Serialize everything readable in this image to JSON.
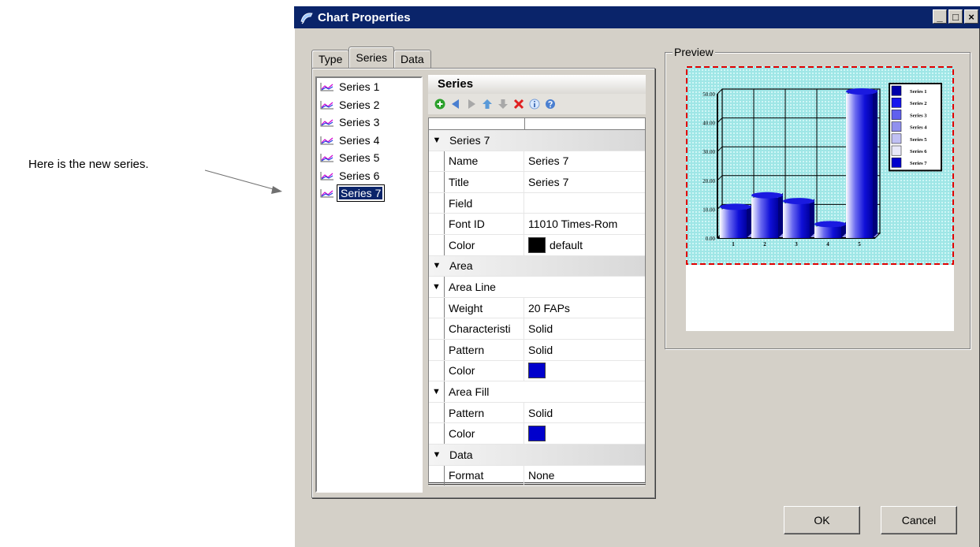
{
  "annotation": {
    "text": "Here is the new series."
  },
  "window": {
    "title": "Chart Properties",
    "controls": {
      "minimize": "_",
      "maximize": "□",
      "close": "×"
    }
  },
  "tabs": [
    "Type",
    "Series",
    "Data"
  ],
  "series_list": [
    "Series 1",
    "Series 2",
    "Series 3",
    "Series 4",
    "Series 5",
    "Series 6",
    "Series 7"
  ],
  "properties": {
    "header": "Series",
    "rows": [
      {
        "kind": "group",
        "label": "Series 7"
      },
      {
        "kind": "prop",
        "name": "Name",
        "value": "Series 7"
      },
      {
        "kind": "prop",
        "name": "Title",
        "value": "Series 7"
      },
      {
        "kind": "prop",
        "name": "Field",
        "value": ""
      },
      {
        "kind": "prop",
        "name": "Font ID",
        "value": "11010 Times-Rom"
      },
      {
        "kind": "prop",
        "name": "Color",
        "value": "default",
        "swatch": "#000000"
      },
      {
        "kind": "group",
        "label": "Area"
      },
      {
        "kind": "subgroup",
        "label": "Area Line"
      },
      {
        "kind": "prop",
        "name": "Weight",
        "value": "20 FAPs"
      },
      {
        "kind": "prop",
        "name": "Characteristi",
        "value": "Solid"
      },
      {
        "kind": "prop",
        "name": "Pattern",
        "value": "Solid"
      },
      {
        "kind": "prop",
        "name": "Color",
        "value": "",
        "swatch": "#0000cc"
      },
      {
        "kind": "subgroup",
        "label": "Area Fill"
      },
      {
        "kind": "prop",
        "name": "Pattern",
        "value": "Solid"
      },
      {
        "kind": "prop",
        "name": "Color",
        "value": "",
        "swatch": "#0000cc"
      },
      {
        "kind": "group",
        "label": "Data"
      },
      {
        "kind": "prop",
        "name": "Format",
        "value": "None"
      }
    ]
  },
  "preview": {
    "label": "Preview",
    "chart_data": {
      "type": "bar",
      "categories": [
        "1",
        "2",
        "3",
        "4",
        "5"
      ],
      "y_ticks": [
        "0.00",
        "10.00",
        "20.00",
        "30.00",
        "40.00",
        "50.00"
      ],
      "ylim": [
        0,
        50
      ],
      "values": [
        10,
        14,
        12,
        4,
        50
      ],
      "legend": [
        "Series 1",
        "Series 2",
        "Series 3",
        "Series 4",
        "Series 5",
        "Series 6",
        "Series 7"
      ],
      "legend_colors": [
        "#0000aa",
        "#1515ee",
        "#6060ee",
        "#9090ee",
        "#c0c0f4",
        "#e8e8f8",
        "#0000cc"
      ],
      "colors": {
        "background": "#a8ecec",
        "border": "#e00000",
        "bar": "#0000cc"
      }
    }
  },
  "buttons": {
    "ok": "OK",
    "cancel": "Cancel"
  }
}
